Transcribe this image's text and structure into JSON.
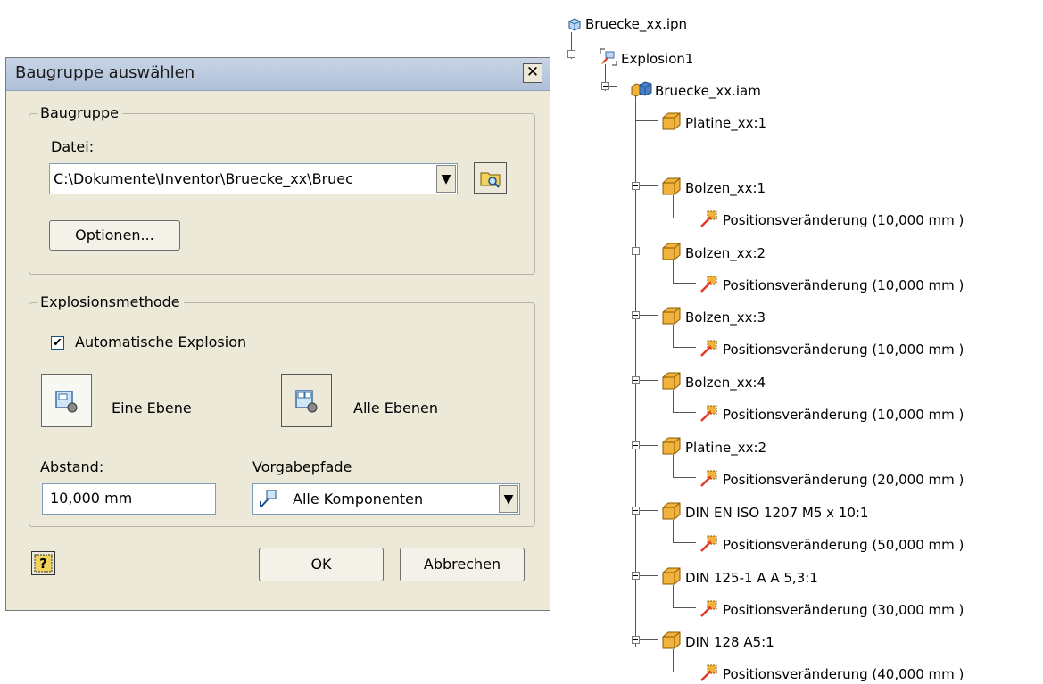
{
  "dialog": {
    "title": "Baugruppe auswählen",
    "group_baugruppe": "Baugruppe",
    "datei_label": "Datei:",
    "datei_value": "C:\\Dokumente\\Inventor\\Bruecke_xx\\Bruec",
    "optionen_button": "Optionen...",
    "group_explosionsmethode": "Explosionsmethode",
    "auto_explosion_label": "Automatische Explosion",
    "auto_explosion_checked": true,
    "eine_ebene_label": "Eine Ebene",
    "alle_ebenen_label": "Alle Ebenen",
    "abstand_label": "Abstand:",
    "abstand_value": "10,000 mm",
    "vorgabepfade_label": "Vorgabepfade",
    "vorgabepfade_value": "Alle Komponenten",
    "ok_button": "OK",
    "cancel_button": "Abbrechen",
    "help_icon": "help-icon",
    "close_icon": "close-icon"
  },
  "tree": {
    "root": "Bruecke_xx.ipn",
    "explosion": "Explosion1",
    "assembly": "Bruecke_xx.iam",
    "items": [
      {
        "label": "Platine_xx:1",
        "change": null
      },
      {
        "label": "Bolzen_xx:1",
        "change": "Positionsveränderung (10,000 mm )"
      },
      {
        "label": "Bolzen_xx:2",
        "change": "Positionsveränderung (10,000 mm )"
      },
      {
        "label": "Bolzen_xx:3",
        "change": "Positionsveränderung (10,000 mm )"
      },
      {
        "label": "Bolzen_xx:4",
        "change": "Positionsveränderung (10,000 mm )"
      },
      {
        "label": "Platine_xx:2",
        "change": "Positionsveränderung (20,000 mm )"
      },
      {
        "label": "DIN EN ISO 1207 M5 x 10:1",
        "change": "Positionsveränderung (50,000 mm )"
      },
      {
        "label": "DIN 125-1 A A 5,3:1",
        "change": "Positionsveränderung (30,000 mm )"
      },
      {
        "label": "DIN 128 A5:1",
        "change": "Positionsveränderung (40,000 mm )"
      }
    ]
  },
  "colors": {
    "dialog_bg": "#ECE9D8",
    "part_icon": "#F2B33D",
    "tweak_icon": "#E23B2A"
  }
}
